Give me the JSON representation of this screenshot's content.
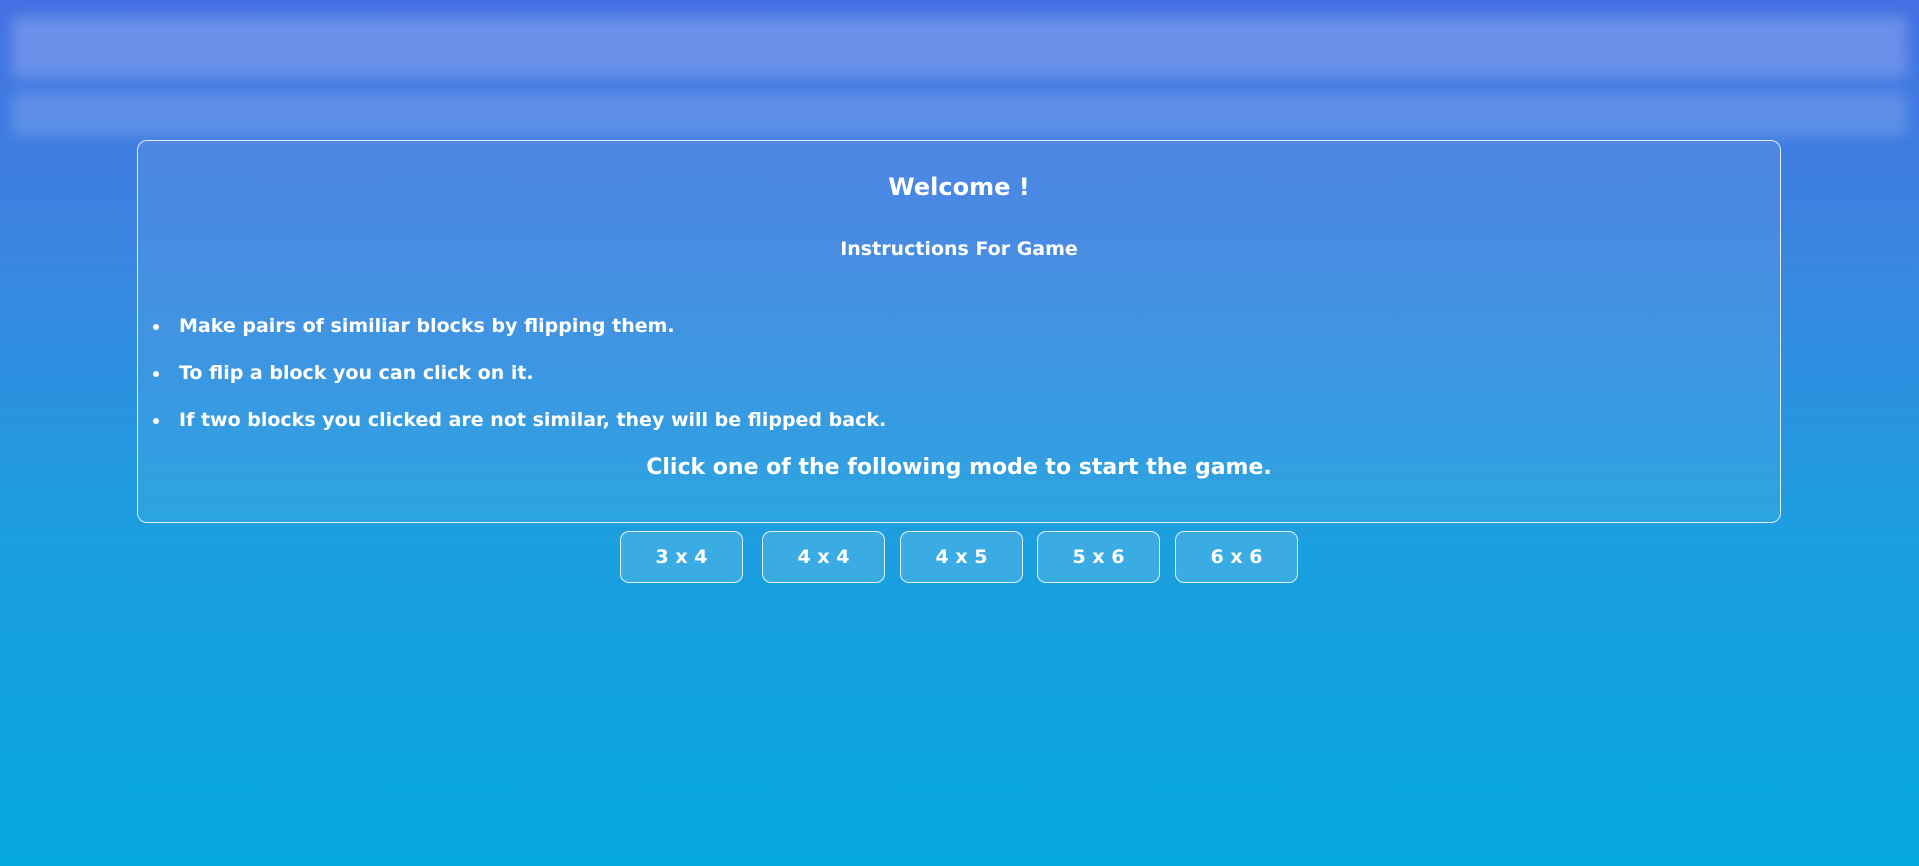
{
  "header": {
    "title": ""
  },
  "welcome": {
    "title": "Welcome !",
    "subtitle": "Instructions For Game",
    "instructions": [
      "Make pairs of similiar blocks by flipping them.",
      "To flip a block you can click on it.",
      "If two blocks you clicked are not similar, they will be flipped back."
    ],
    "prompt": "Click one of the following mode to start the game."
  },
  "modes": [
    {
      "label": "3 x 4"
    },
    {
      "label": "4 x 4"
    },
    {
      "label": "4 x 5"
    },
    {
      "label": "5 x 6"
    },
    {
      "label": "6 x 6"
    }
  ],
  "colors": {
    "background_top": "#4470e3",
    "background_bottom": "#05a8dd",
    "text": "#ffffff"
  }
}
